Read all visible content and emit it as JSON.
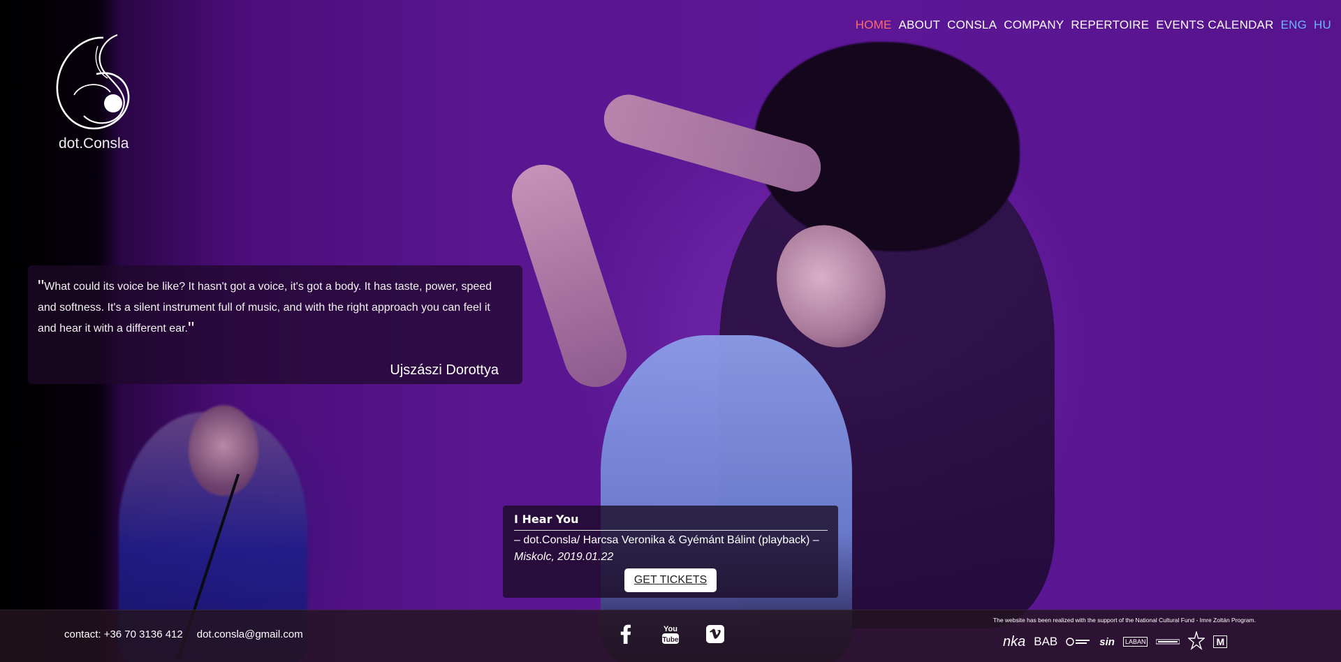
{
  "brand": {
    "name": "dot.Consla"
  },
  "nav": {
    "items": [
      {
        "label": "HOME",
        "active": true
      },
      {
        "label": "ABOUT",
        "active": false
      },
      {
        "label": "CONSLA",
        "active": false
      },
      {
        "label": "COMPANY",
        "active": false
      },
      {
        "label": "REPERTOIRE",
        "active": false
      },
      {
        "label": "EVENTS CALENDAR",
        "active": false
      }
    ],
    "languages": [
      "ENG",
      "HU"
    ],
    "active_color": "#ff6b6b",
    "lang_color": "#6ab4ff"
  },
  "quote": {
    "open_mark": "\"",
    "text": "What could its voice be like? It hasn't got a voice, it's got a body. It has taste, power, speed and softness. It's a silent instrument full of music, and with the right approach you can feel it and hear it with a different ear.",
    "close_mark": "\"",
    "author": "Ujszászi Dorottya"
  },
  "event": {
    "title": "I Hear You",
    "meta": "– dot.Consla/ Harcsa Veronika & Gyémánt Bálint (playback) –",
    "place": "Miskolc, 2019.01.22",
    "button": "GET TICKETS"
  },
  "footer": {
    "phone": "contact: +36 70 3136 412",
    "email": "dot.consla@gmail.com",
    "socials": [
      "facebook-icon",
      "youtube-icon",
      "vimeo-icon"
    ],
    "youtube_label": "You Tube",
    "support_text": "The website has been realized with the support of the National Cultural Fund - Imre Zoltán Program.",
    "sponsors": [
      "nka",
      "BAB",
      "sin",
      "LABAN",
      "M"
    ]
  }
}
